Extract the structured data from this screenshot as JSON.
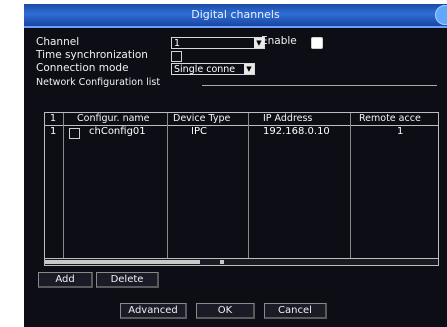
{
  "dialog": {
    "title": "Digital channels"
  },
  "form": {
    "channel_label": "Channel",
    "channel_value": "1",
    "enable_label": "Enable",
    "time_sync_label": "Time synchronization",
    "connection_mode_label": "Connection mode",
    "connection_mode_value": "Single conne",
    "group_label": "Network Configuration list"
  },
  "table": {
    "columns": [
      "1",
      "Configur. name",
      "Device Type",
      "IP Address",
      "Remote acce"
    ],
    "rows": [
      {
        "index": "1",
        "name": "chConfig01",
        "device_type": "IPC",
        "ip": "192.168.0.10",
        "remote": "1"
      }
    ]
  },
  "buttons": {
    "add": "Add",
    "delete": "Delete",
    "advanced": "Advanced",
    "ok": "OK",
    "cancel": "Cancel"
  },
  "colors": {
    "titlebar": "#2e6ed4",
    "background": "#0d0d16",
    "text": "#f0f0f0"
  }
}
